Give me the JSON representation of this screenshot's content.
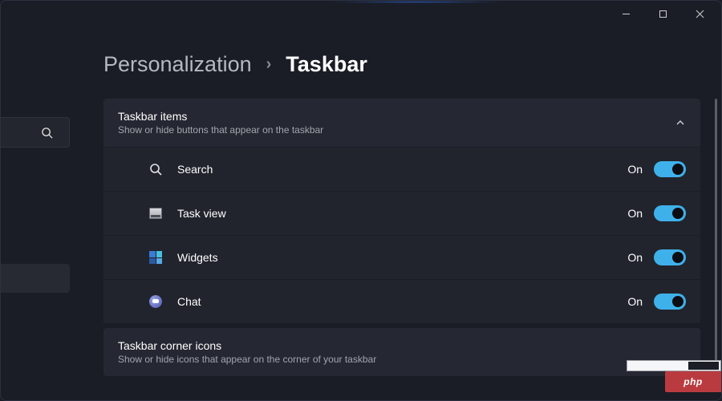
{
  "breadcrumb": {
    "parent": "Personalization",
    "separator": "›",
    "current": "Taskbar"
  },
  "sections": {
    "taskbar_items": {
      "title": "Taskbar items",
      "description": "Show or hide buttons that appear on the taskbar",
      "expanded": true
    },
    "corner_icons": {
      "title": "Taskbar corner icons",
      "description": "Show or hide icons that appear on the corner of your taskbar"
    }
  },
  "items": [
    {
      "icon": "search-icon",
      "label": "Search",
      "state": "On",
      "on": true
    },
    {
      "icon": "taskview-icon",
      "label": "Task view",
      "state": "On",
      "on": true
    },
    {
      "icon": "widgets-icon",
      "label": "Widgets",
      "state": "On",
      "on": true
    },
    {
      "icon": "chat-icon",
      "label": "Chat",
      "state": "On",
      "on": true
    }
  ],
  "watermark": "php"
}
